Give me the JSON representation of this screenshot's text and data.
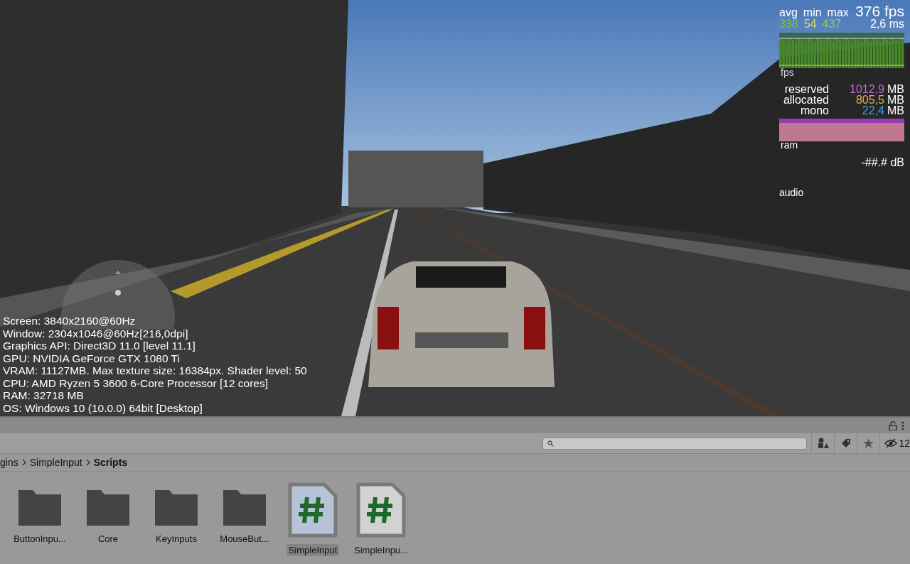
{
  "game_view": {
    "stats": {
      "headers": [
        "avg",
        "min",
        "max"
      ],
      "values": [
        {
          "text": "338",
          "color": "#7fbf4f"
        },
        {
          "text": "54",
          "color": "#e6d84a"
        },
        {
          "text": "437",
          "color": "#8ed04c"
        }
      ],
      "fps": "376 fps",
      "frame_time": "2,6 ms",
      "graph_label": "fps",
      "memory": [
        {
          "label": "reserved",
          "value": "1012,9",
          "unit": "MB",
          "color": "#c466d8"
        },
        {
          "label": "allocated",
          "value": "805,5",
          "unit": "MB",
          "color": "#eab24a"
        },
        {
          "label": "mono",
          "value": "22,4",
          "unit": "MB",
          "color": "#3f9fe6"
        }
      ],
      "ram_label": "ram",
      "audio_level": "-##.# dB",
      "audio_label": "audio"
    },
    "system_info": [
      "Screen: 3840x2160@60Hz",
      "Window: 2304x1046@60Hz[216,0dpi]",
      "Graphics API: Direct3D 11.0 [level 11.1]",
      "GPU: NVIDIA GeForce GTX 1080 Ti",
      "VRAM: 11127MB. Max texture size: 16384px. Shader level: 50",
      "CPU: AMD Ryzen 5 3600 6-Core Processor  [12 cores]",
      "RAM: 32718 MB",
      "OS: Windows 10  (10.0.0) 64bit [Desktop]"
    ]
  },
  "project": {
    "hidden_count": "12",
    "breadcrumb": [
      "gins",
      "SimpleInput",
      "Scripts"
    ],
    "assets": [
      {
        "name": "ButtonInpu...",
        "kind": "folder",
        "selected": false
      },
      {
        "name": "Core",
        "kind": "folder",
        "selected": false
      },
      {
        "name": "KeyInputs",
        "kind": "folder",
        "selected": false
      },
      {
        "name": "MouseBut...",
        "kind": "folder",
        "selected": false
      },
      {
        "name": "SimpleInput",
        "kind": "script",
        "selected": true
      },
      {
        "name": "SimpleInpu...",
        "kind": "script",
        "selected": false
      }
    ]
  }
}
